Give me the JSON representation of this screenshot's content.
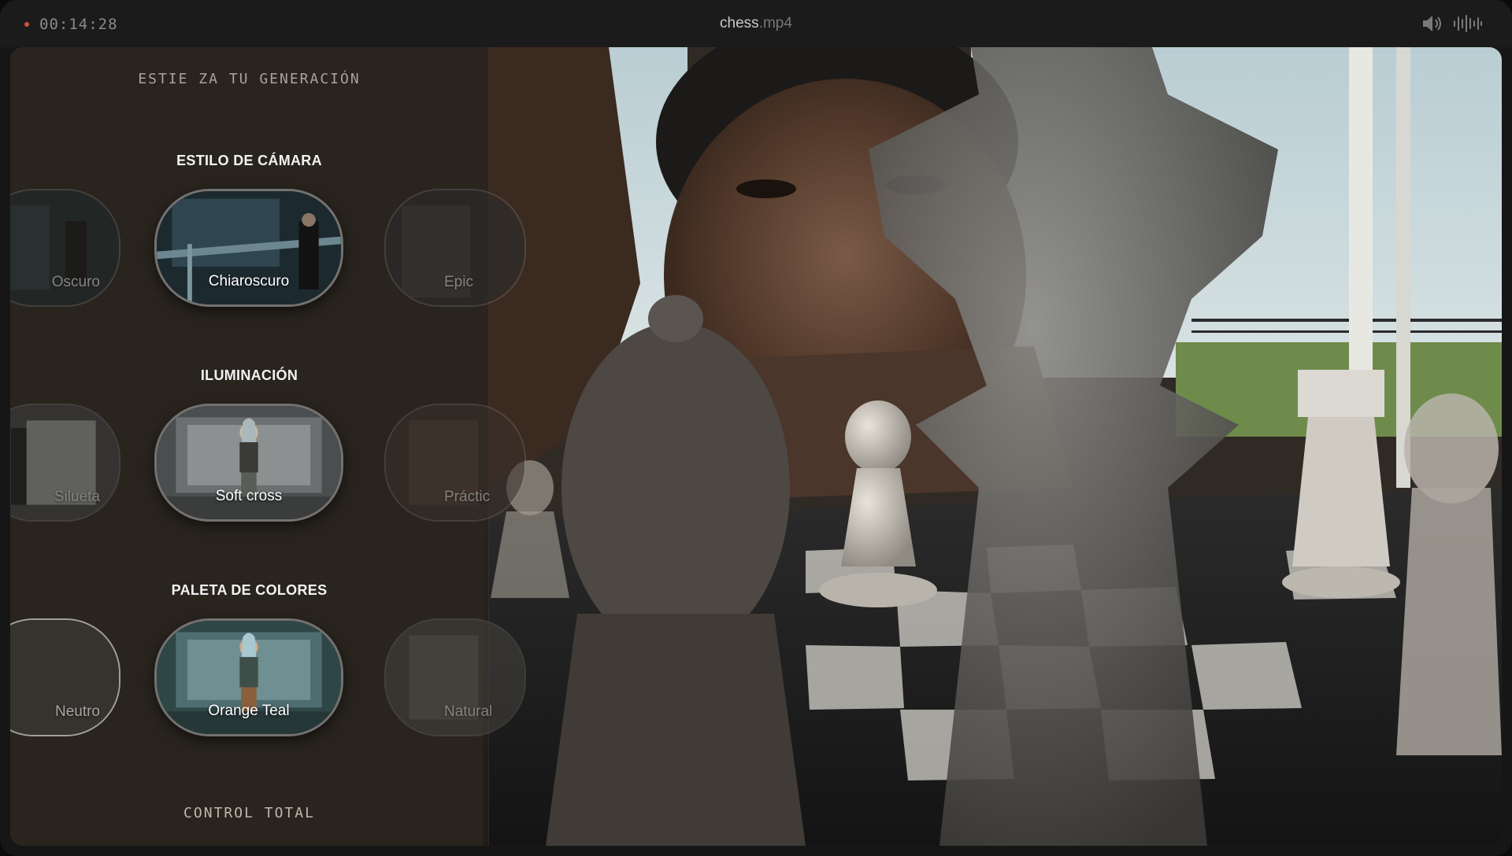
{
  "titlebar": {
    "timecode": "00:14:28",
    "filename_base": "chess",
    "filename_ext": ".mp4",
    "rec_color": "#d0533c"
  },
  "panel": {
    "top_label": "ESTIE ZA TU GENERACIÓN",
    "bottom_label": "CONTROL TOTAL",
    "sections": [
      {
        "title": "ESTILO DE CÁMARA",
        "prev_option": "Oscuro",
        "selected_option": "Chiaroscuro",
        "next_option": "Epic"
      },
      {
        "title": "ILUMINACIÓN",
        "prev_option": "Silueta",
        "selected_option": "Soft cross",
        "next_option": "Práctic"
      },
      {
        "title": "PALETA DE COLORES",
        "prev_option": "Neutro",
        "selected_option": "Orange Teal",
        "next_option": "Natural"
      }
    ]
  },
  "icons": {
    "speaker": "speaker-icon",
    "waveform": "waveform-icon"
  }
}
